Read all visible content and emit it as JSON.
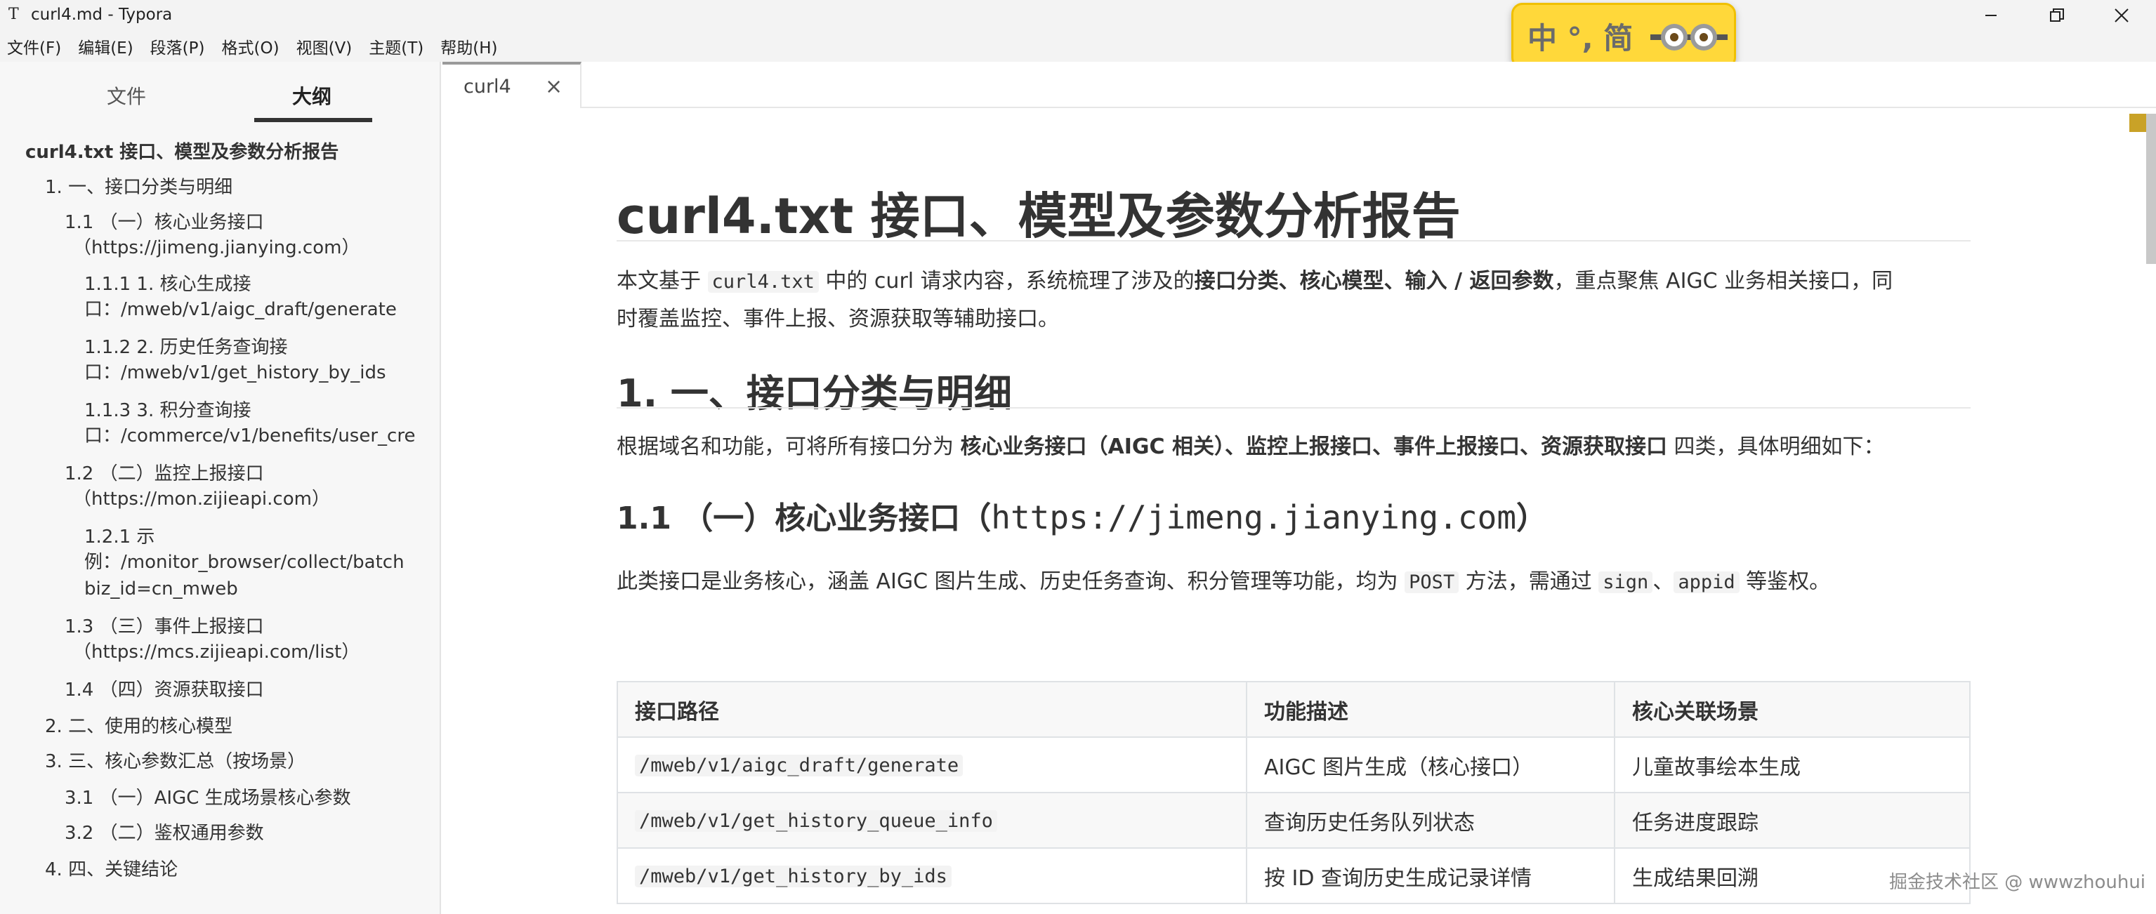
{
  "window": {
    "title": "curl4.md - Typora",
    "app_icon": "T"
  },
  "menu": [
    "文件(F)",
    "编辑(E)",
    "段落(P)",
    "格式(O)",
    "视图(V)",
    "主题(T)",
    "帮助(H)"
  ],
  "ime": {
    "label": "中 °, 简"
  },
  "sidebar": {
    "tabs": {
      "files": "文件",
      "outline": "大纲"
    },
    "outline": [
      {
        "text": "curl4.txt 接口、模型及参数分析报告"
      },
      {
        "text": "1. 一、接口分类与明细"
      },
      {
        "text": "1.1 （一）核心业务接口"
      },
      {
        "text": "（https://jimeng.jianying.com）"
      },
      {
        "text": "1.1.1 1. 核心生成接"
      },
      {
        "text": "口：/mweb/v1/aigc_draft/generate"
      },
      {
        "text": "1.1.2 2. 历史任务查询接"
      },
      {
        "text": "口：/mweb/v1/get_history_by_ids"
      },
      {
        "text": "1.1.3 3. 积分查询接"
      },
      {
        "text": "口：/commerce/v1/benefits/user_cre"
      },
      {
        "text": "1.2 （二）监控上报接口"
      },
      {
        "text": "（https://mon.zijieapi.com）"
      },
      {
        "text": "1.2.1 示"
      },
      {
        "text": "例：/monitor_browser/collect/batch"
      },
      {
        "text": "biz_id=cn_mweb"
      },
      {
        "text": "1.3 （三）事件上报接口"
      },
      {
        "text": "（https://mcs.zijieapi.com/list）"
      },
      {
        "text": "1.4 （四）资源获取接口"
      },
      {
        "text": "2. 二、使用的核心模型"
      },
      {
        "text": "3. 三、核心参数汇总（按场景）"
      },
      {
        "text": "3.1 （一）AIGC 生成场景核心参数"
      },
      {
        "text": "3.2 （二）鉴权通用参数"
      },
      {
        "text": "4. 四、关键结论"
      }
    ]
  },
  "tab": {
    "label": "curl4",
    "close": "×"
  },
  "doc": {
    "h1": "curl4.txt 接口、模型及参数分析报告",
    "intro": {
      "a": "本文基于 ",
      "code": "curl4.txt",
      "b": " 中的 curl 请求内容，系统梳理了涉及的",
      "bold": "接口分类、核心模型、输入 / 返回参数",
      "c": "，重点聚焦 AIGC 业务相关接口，同",
      "line2": "时覆盖监控、事件上报、资源获取等辅助接口。"
    },
    "h2": "1. 一、接口分类与明细",
    "p2": {
      "a": "根据域名和功能，可将所有接口分为 ",
      "bold": "核心业务接口（AIGC 相关）、监控上报接口、事件上报接口、资源获取接口",
      "b": " 四类，具体明细如下："
    },
    "h3": {
      "prefix": "1.1 （一）核心业务接口（",
      "url": "https://jimeng.jianying.com",
      "suffix": "）"
    },
    "p3": {
      "a": "此类接口是业务核心，涵盖 AIGC 图片生成、历史任务查询、积分管理等功能，均为 ",
      "code1": "POST",
      "b": " 方法，需通过 ",
      "code2": "sign",
      "c": "、",
      "code3": "appid",
      "d": " 等鉴权。"
    },
    "table": {
      "headers": [
        "接口路径",
        "功能描述",
        "核心关联场景"
      ],
      "rows": [
        [
          "/mweb/v1/aigc_draft/generate",
          "AIGC 图片生成（核心接口）",
          "儿童故事绘本生成"
        ],
        [
          "/mweb/v1/get_history_queue_info",
          "查询历史任务队列状态",
          "任务进度跟踪"
        ],
        [
          "/mweb/v1/get_history_by_ids",
          "按 ID 查询历史生成记录详情",
          "生成结果回溯"
        ]
      ]
    }
  },
  "watermark": "掘金技术社区 @ wwwzhouhui"
}
